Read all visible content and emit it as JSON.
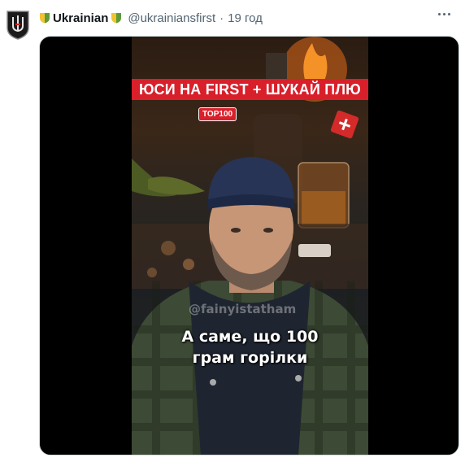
{
  "tweet": {
    "display_name": "Ukrainian",
    "handle": "@ukrainiansfirst",
    "separator": "·",
    "time": "19 год"
  },
  "video": {
    "banner_text": "ЮСИ НА FIRST + ШУКАЙ ПЛЮ",
    "badge_text": "TOP100",
    "watermark": "@fainyistatham",
    "subtitle_lines": [
      "А саме, що 100",
      "грам горілки"
    ]
  },
  "colors": {
    "banner_red": "#d81f2a",
    "badge_green": "#5b9b3b",
    "badge_yellow": "#f2c230"
  }
}
